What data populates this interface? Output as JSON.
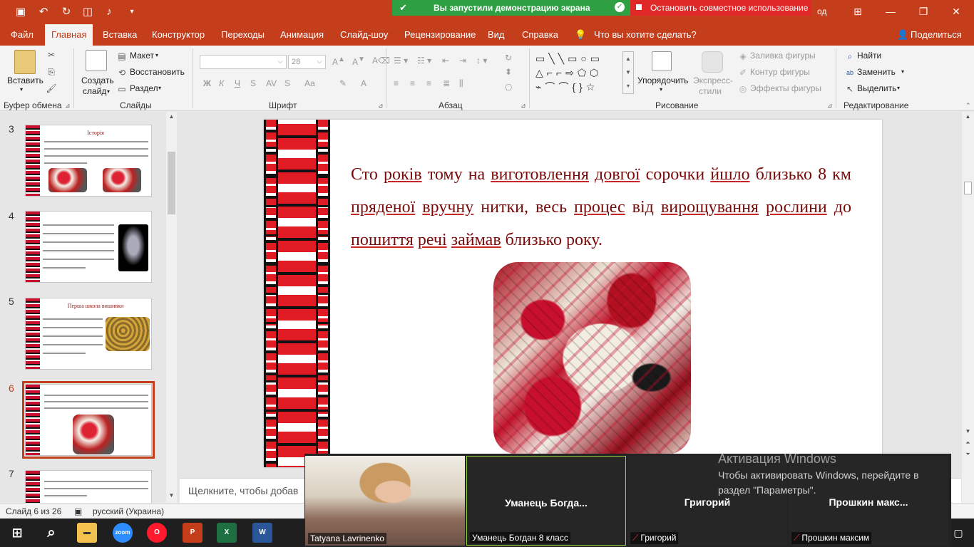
{
  "titlebar": {
    "fragment": "од",
    "share_banner": "Вы запустили демонстрацию экрана",
    "stop_share": "Остановить совместное использование"
  },
  "tabs": [
    {
      "label": "Файл"
    },
    {
      "label": "Главная"
    },
    {
      "label": "Вставка"
    },
    {
      "label": "Конструктор"
    },
    {
      "label": "Переходы"
    },
    {
      "label": "Анимация"
    },
    {
      "label": "Слайд-шоу"
    },
    {
      "label": "Рецензирование"
    },
    {
      "label": "Вид"
    },
    {
      "label": "Справка"
    }
  ],
  "tellme": "Что вы хотите сделать?",
  "share_label": "Поделиться",
  "ribbon": {
    "clipboard": {
      "paste": "Вставить",
      "label": "Буфер обмена"
    },
    "slides": {
      "new_line1": "Создать",
      "new_line2": "слайд",
      "layout": "Макет",
      "reset": "Восстановить",
      "section": "Раздел",
      "label": "Слайды"
    },
    "font": {
      "size": "28",
      "label": "Шрифт",
      "bold": "Ж",
      "italic": "К",
      "underline": "Ч",
      "strike": "S",
      "aa": "Аа"
    },
    "paragraph": {
      "label": "Абзац"
    },
    "drawing": {
      "arrange": "Упорядочить",
      "styles_line1": "Экспресс-",
      "styles_line2": "стили",
      "fill": "Заливка фигуры",
      "outline": "Контур фигуры",
      "effects": "Эффекты фигуры",
      "label": "Рисование"
    },
    "editing": {
      "find": "Найти",
      "replace": "Заменить",
      "select": "Выделить",
      "label": "Редактирование"
    }
  },
  "thumbnails": [
    {
      "num": "3",
      "title": "Історія"
    },
    {
      "num": "4",
      "title": ""
    },
    {
      "num": "5",
      "title": "Перша школа вишивки"
    },
    {
      "num": "6",
      "title": ""
    },
    {
      "num": "7",
      "title": ""
    }
  ],
  "slide": {
    "text_parts": [
      {
        "t": "Сто ",
        "u": false
      },
      {
        "t": "років",
        "u": true
      },
      {
        "t": " тому на ",
        "u": false
      },
      {
        "t": "виготовлення",
        "u": true
      },
      {
        "t": " ",
        "u": false
      },
      {
        "t": "довгої",
        "u": true
      },
      {
        "t": " сорочки ",
        "u": false
      },
      {
        "t": "йшло",
        "u": true
      },
      {
        "t": " близько 8 км ",
        "u": false
      },
      {
        "t": "пряденої",
        "u": true
      },
      {
        "t": " ",
        "u": false
      },
      {
        "t": "вручну",
        "u": true
      },
      {
        "t": " нитки, весь ",
        "u": false
      },
      {
        "t": "процес",
        "u": true
      },
      {
        "t": " від ",
        "u": false
      },
      {
        "t": "вирощування",
        "u": true
      },
      {
        "t": " ",
        "u": false
      },
      {
        "t": "рослини",
        "u": true
      },
      {
        "t": " до ",
        "u": false
      },
      {
        "t": "пошиття",
        "u": true
      },
      {
        "t": " ",
        "u": false
      },
      {
        "t": "речі",
        "u": true
      },
      {
        "t": " ",
        "u": false
      },
      {
        "t": "займав",
        "u": true
      },
      {
        "t": " близько року.",
        "u": false
      }
    ]
  },
  "notes_placeholder": "Щелкните, чтобы добав",
  "status": {
    "slide_count": "Слайд 6 из 26",
    "language": "русский (Украина)"
  },
  "zoom": {
    "participants": [
      {
        "caption": "Tatyana Lavrinenko",
        "name": ""
      },
      {
        "caption": "Уманець Богдан 8 класс",
        "name": "Уманець  Богда..."
      },
      {
        "caption": "Григорий",
        "name": "Григорий"
      },
      {
        "caption": "Прошкин максим",
        "name": "Прошкин  макс..."
      }
    ]
  },
  "watermark": {
    "title": "Активация Windows",
    "line": "Чтобы активировать Windows, перейдите в раздел \"Параметры\"."
  },
  "colors": {
    "accent": "#c43e1c",
    "slide_text": "#7a0b0b",
    "zoom_active": "#9bd33c"
  }
}
